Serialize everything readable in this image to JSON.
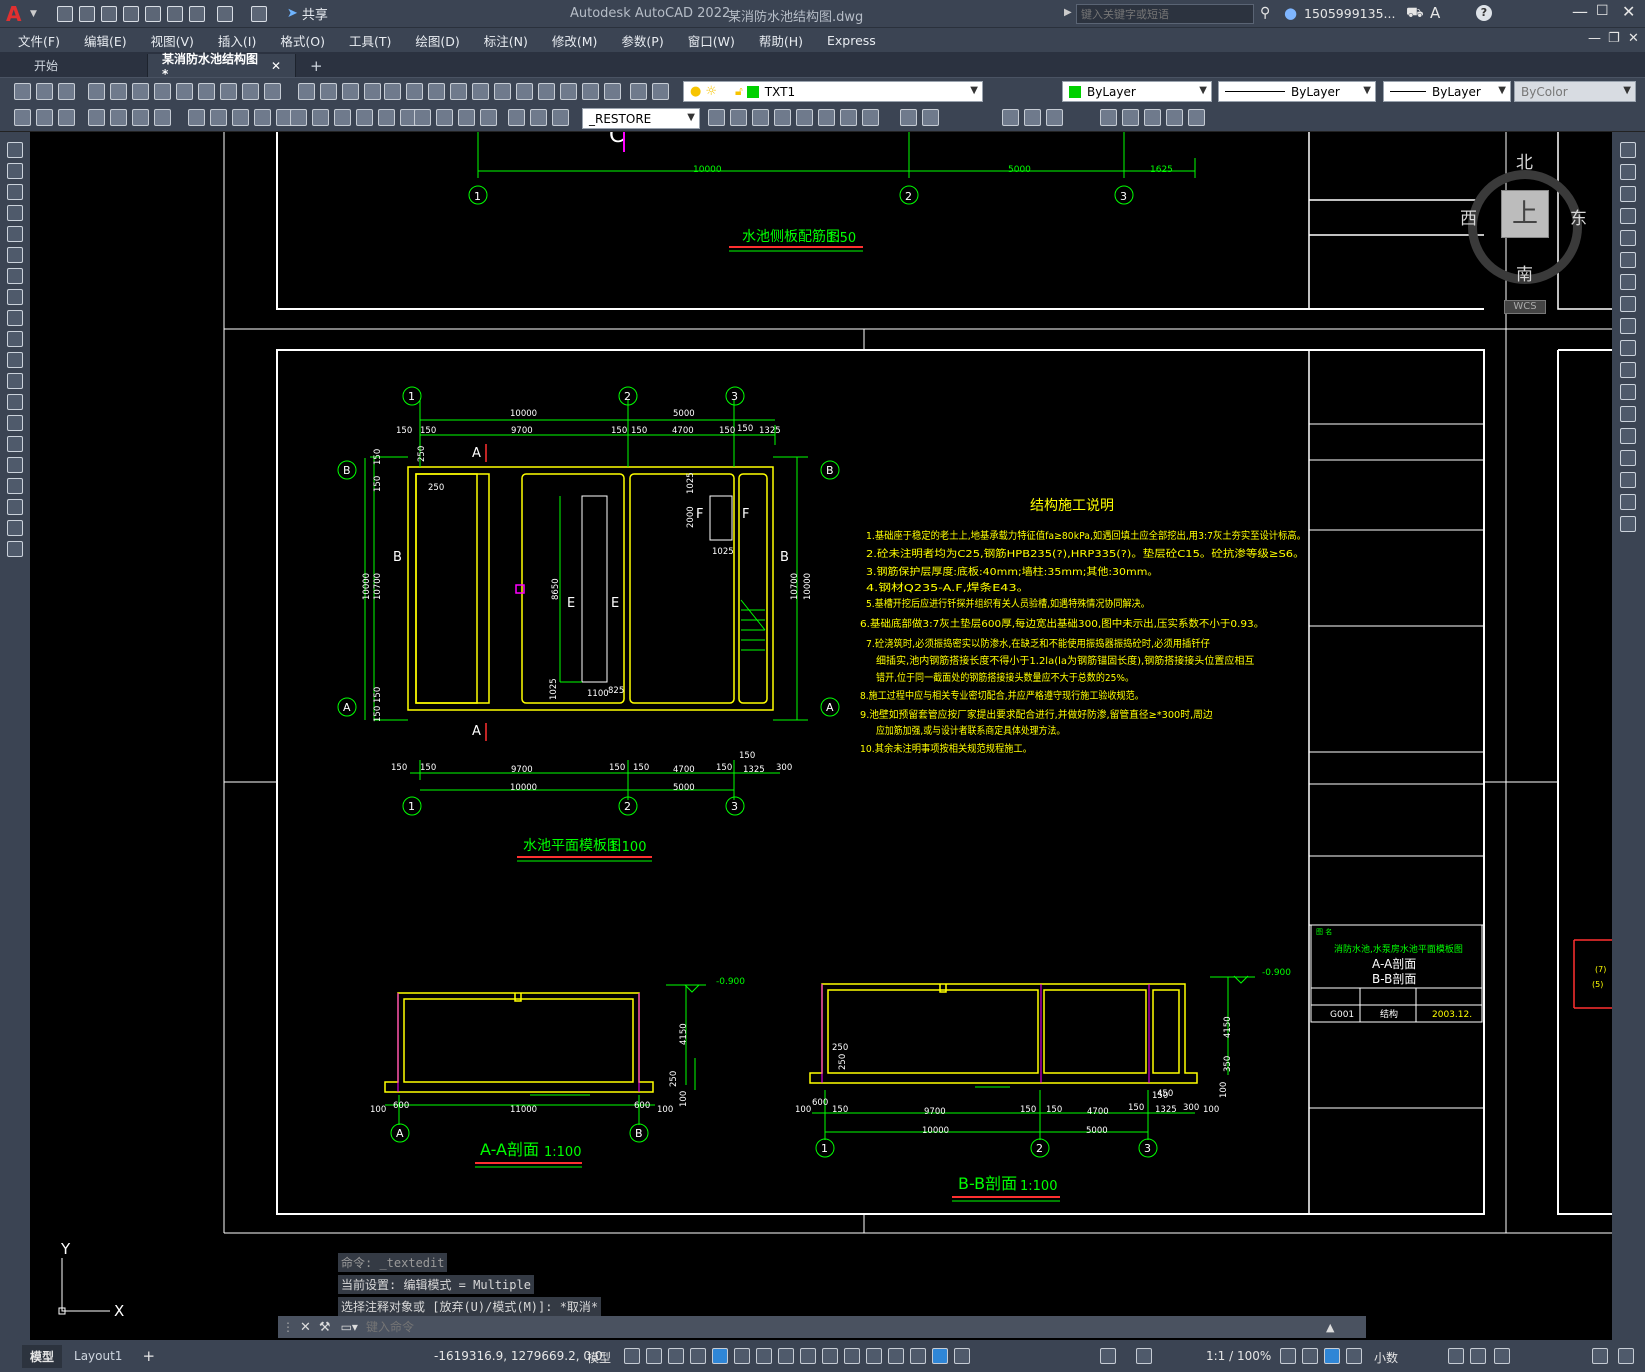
{
  "titlebar": {
    "app_title": "Autodesk AutoCAD 2022",
    "file_name": "某消防水池结构图.dwg",
    "share_label": "共享",
    "search_placeholder": "键入关键字或短语",
    "user_name": "1505999135..."
  },
  "menu": [
    "文件(F)",
    "编辑(E)",
    "视图(V)",
    "插入(I)",
    "格式(O)",
    "工具(T)",
    "绘图(D)",
    "标注(N)",
    "修改(M)",
    "参数(P)",
    "窗口(W)",
    "帮助(H)",
    "Express"
  ],
  "tabs": [
    {
      "label": "开始",
      "active": false
    },
    {
      "label": "某消防水池结构图*",
      "active": true
    }
  ],
  "properties": {
    "layer": "TXT1",
    "color": "ByLayer",
    "linetype": "ByLayer",
    "lineweight": "ByLayer",
    "plotstyle": "ByColor",
    "dimstyle": "_RESTORE"
  },
  "viewcube": {
    "north": "北",
    "south": "南",
    "east": "东",
    "west": "西",
    "top": "上",
    "wcs": "WCS"
  },
  "drawing": {
    "top_title": "水池侧板配筋图",
    "top_scale": "1:50",
    "top_dims": [
      "10000",
      "5000",
      "1625"
    ],
    "axes": [
      "1",
      "2",
      "3"
    ],
    "axes_ab": [
      "A",
      "B"
    ],
    "plan_title": "水池平面模板图",
    "plan_scale": "1:100",
    "plan_dims_top_total": [
      "10000",
      "5000"
    ],
    "plan_dims_top_parts": [
      "150",
      "150",
      "9700",
      "150",
      "150",
      "4700",
      "150",
      "150",
      "1325"
    ],
    "plan_dims_bottom_parts": [
      "150",
      "150",
      "9700",
      "150",
      "150",
      "4700",
      "150",
      "150",
      "1325",
      "300"
    ],
    "plan_dims_bottom_total": [
      "10000",
      "5000"
    ],
    "plan_vert_dims": [
      "150",
      "150",
      "10700",
      "10000",
      "150",
      "150"
    ],
    "plan_inner_dims": [
      "250",
      "1025",
      "2000",
      "1025",
      "8650",
      "1025",
      "1100",
      "825"
    ],
    "section_marks": [
      "A",
      "B",
      "E",
      "F"
    ],
    "notes_title": "结构施工说明",
    "notes": [
      "1.基础座于稳定的老土上,地基承载力特征值fa≥80kPa,如遇回填土应全部挖出,用3:7灰土夯实至设计标高。",
      "2.砼未注明者均为C25,钢筋HPB235(?),HRP335(?)。垫层砼C15。砼抗渗等级≥S6。",
      "3.钢筋保护层厚度:底板:40mm;墙柱:35mm;其他:30mm。",
      "4.钢材Q235-A.F,焊条E43。",
      "5.基槽开挖后应进行钎探并组织有关人员验槽,如遇特殊情况协同解决。",
      "6.基础底部做3:7灰土垫层600厚,每边宽出基础300,图中未示出,压实系数不小于0.93。",
      "7.砼浇筑时,必须振捣密实以防渗水,在缺乏和不能使用振捣器振捣砼时,必须用插钎仔",
      "细插实,池内钢筋搭接长度不得小于1.2la(la为钢筋锚固长度),钢筋搭接接头位置应相互",
      "错开,位于同一截面处的钢筋搭接接头数量应不大于总数的25%。",
      "8.施工过程中应与相关专业密切配合,并应严格遵守现行施工验收规范。",
      "9.池壁如预留套管应按厂家提出要求配合进行,并做好防渗,留管直径≥*300时,周边",
      "应加筋加强,或与设计者联系商定具体处理方法。",
      "10.其余未注明事项按相关规范规程施工。"
    ],
    "sec_aa_title": "A-A剖面",
    "sec_aa_scale": "1:100",
    "sec_aa_dims": [
      "100",
      "600",
      "11000",
      "600",
      "100",
      "250",
      "4150",
      "100"
    ],
    "sec_aa_level": "-0.900",
    "sec_bb_title": "B-B剖面",
    "sec_bb_scale": "1:100",
    "sec_bb_dims": [
      "100",
      "600",
      "150",
      "9700",
      "150",
      "150",
      "4700",
      "150",
      "150",
      "1325",
      "300",
      "100",
      "10000",
      "5000",
      "250",
      "250",
      "4150",
      "350",
      "450"
    ],
    "sec_bb_level": "-0.900",
    "titleblock": {
      "project": "消防水池,水泵房水池平面模板图",
      "line1": "A-A剖面",
      "line2": "B-B剖面",
      "code": "G001",
      "type": "结构",
      "date": "2003.12."
    }
  },
  "command": {
    "history": [
      "命令: _textedit",
      "当前设置: 编辑模式 = Multiple",
      "选择注释对象或 [放弃(U)/模式(M)]: *取消*"
    ],
    "placeholder": "键入命令"
  },
  "ucs": {
    "x": "X",
    "y": "Y"
  },
  "status": {
    "model_tab": "模型",
    "layout_tab": "Layout1",
    "coords": "-1619316.9, 1279669.2, 0.0",
    "space": "模型",
    "scale": "1:1 / 100%",
    "units": "小数"
  },
  "colors": {
    "dim": "#00ff00",
    "wall": "#ffff00",
    "frame": "#ffffff",
    "section": "#ff00ff",
    "title_red": "#ff0000"
  }
}
